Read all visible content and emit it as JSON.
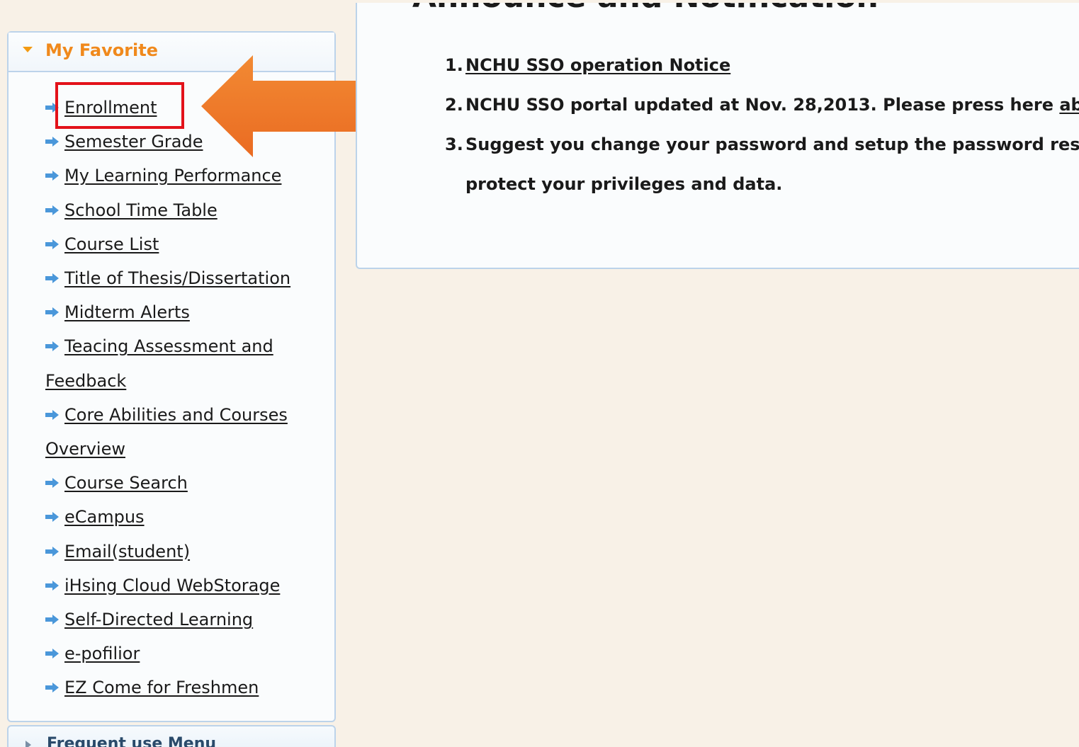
{
  "sidebar": {
    "favorite": {
      "title": "My Favorite",
      "items": [
        {
          "label": "Enrollment"
        },
        {
          "label": "Semester Grade"
        },
        {
          "label": "My Learning Performance"
        },
        {
          "label": "School Time Table"
        },
        {
          "label": "Course List"
        },
        {
          "label": "Title of Thesis/Dissertation"
        },
        {
          "label": "Midterm Alerts"
        },
        {
          "label": "Teacing Assessment and Feedback"
        },
        {
          "label": "Core Abilities and Courses Overview"
        },
        {
          "label": "Course Search"
        },
        {
          "label": "eCampus"
        },
        {
          "label": "Email(student)"
        },
        {
          "label": "iHsing Cloud WebStorage"
        },
        {
          "label": "Self-Directed Learning"
        },
        {
          "label": "e-pofilior"
        },
        {
          "label": "EZ Come for Freshmen"
        }
      ]
    },
    "frequent": {
      "title": "Frequent use Menu"
    }
  },
  "announcement": {
    "title": "Announce and Notification",
    "items": [
      {
        "number": "1.",
        "link_text": "NCHU SSO operation Notice"
      },
      {
        "number": "2.",
        "text": "NCHU SSO portal updated at Nov. 28,2013. Please press here ",
        "link_text": "about t"
      },
      {
        "number": "3.",
        "text": "Suggest you change your password and setup the password respon",
        "continuation": "protect your privileges and data."
      }
    ]
  },
  "icons": {
    "menu_item_icon": "arrow-right-icon",
    "favorite_toggle_icon": "caret-down-icon",
    "frequent_toggle_icon": "caret-right-icon"
  },
  "colors": {
    "accent_orange": "#f0891c",
    "highlight_red": "#e3121a",
    "panel_border": "#bcd3ea",
    "menu_arrow_blue": "#4a97da"
  }
}
